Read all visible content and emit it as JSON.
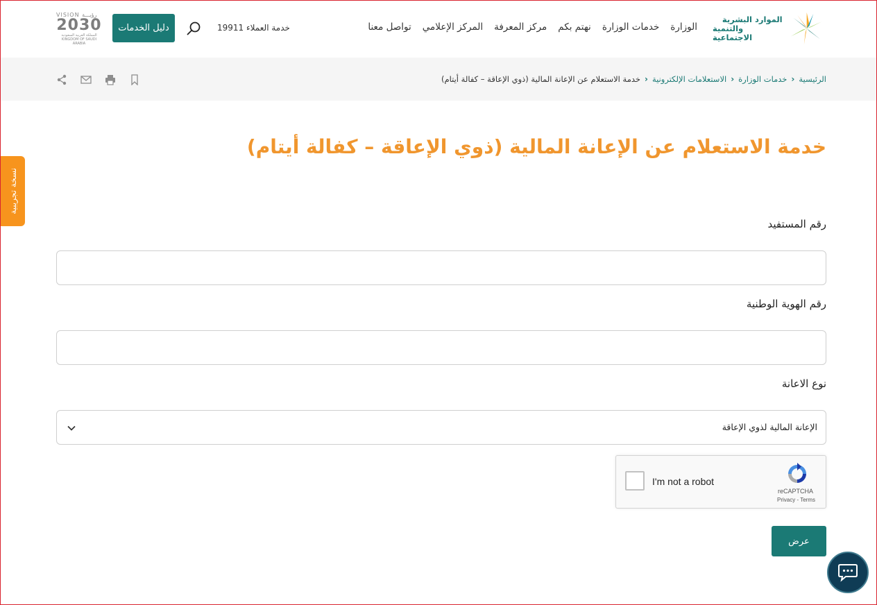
{
  "header": {
    "ministry_logo_line1": "الموارد البشرية",
    "ministry_logo_line2": "والتنمية الاجتماعية",
    "nav": [
      "الوزارة",
      "خدمات الوزارة",
      "نهتم بكم",
      "مركز المعرفة",
      "المركز الإعلامي",
      "تواصل معنا"
    ],
    "hotline": "خدمة العملاء 19911",
    "guide_button": "دليل الخدمات",
    "vision_logo": {
      "line1": "VISION رؤيـــة",
      "line2": "2030",
      "line3": "المملكة العربية السعودية",
      "line4": "KINGDOM OF SAUDI ARABIA"
    }
  },
  "breadcrumb": {
    "items": [
      "الرئيسية",
      "خدمات الوزارة",
      "الاستعلامات الإلكترونية"
    ],
    "current": "خدمة الاستعلام عن الإعانة المالية (ذوي الإعاقة – كفالة أيتام)"
  },
  "side_tab": {
    "label": "نسخة تجريبية"
  },
  "page": {
    "title": "خدمة الاستعلام عن الإعانة المالية (ذوي الإعاقة – كفالة أيتام)"
  },
  "form": {
    "beneficiary_label": "رقم المستفيد",
    "beneficiary_value": "",
    "national_id_label": "رقم الهوية الوطنية",
    "national_id_value": "",
    "aid_type_label": "نوع الاعانة",
    "aid_type_selected": "الإعانة المالية لذوي الإعاقة",
    "submit_label": "عرض"
  },
  "captcha": {
    "label": "I'm not a robot",
    "brand": "reCAPTCHA",
    "terms": "Privacy - Terms"
  },
  "colors": {
    "primary": "#1b7a75",
    "title": "#f0962e",
    "side_tab": "#f7941d",
    "chat": "#0f3c55"
  }
}
